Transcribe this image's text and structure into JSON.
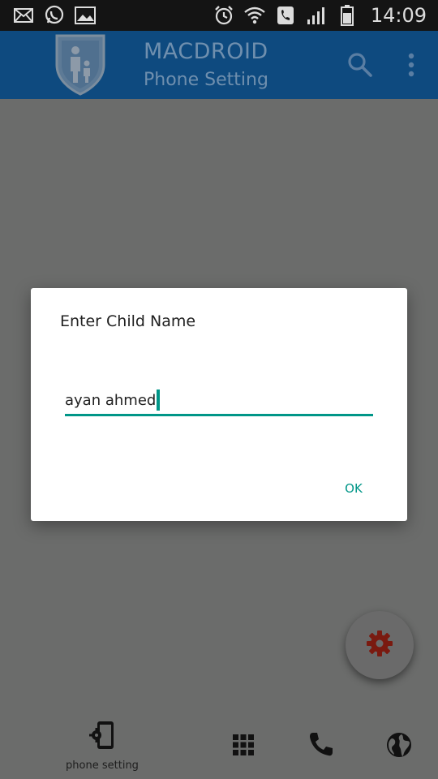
{
  "status_bar": {
    "time": "14:09",
    "left_icons": [
      "mail-icon",
      "whatsapp-icon",
      "image-icon"
    ],
    "right_icons": [
      "alarm-icon",
      "wifi-icon",
      "call-icon",
      "signal-icon",
      "battery-icon"
    ]
  },
  "app_bar": {
    "title": "MACDROID",
    "subtitle": "Phone Setting",
    "logo_icon": "shield-family-icon",
    "actions": [
      "search-icon",
      "more-vert-icon"
    ]
  },
  "dialog": {
    "title": "Enter Child Name",
    "input_value": "ayan ahmed",
    "ok_label": "OK"
  },
  "fab": {
    "icon": "gear-icon",
    "color": "#7a1a10"
  },
  "bottom_nav": {
    "phone_setting_label": "phone setting",
    "items": [
      "phone-settings-icon",
      "apps-grid-icon",
      "phone-icon",
      "globe-icon"
    ]
  },
  "colors": {
    "appbar": "#0e4a7f",
    "accent": "#009688",
    "scrim": "#6b6c6b"
  }
}
